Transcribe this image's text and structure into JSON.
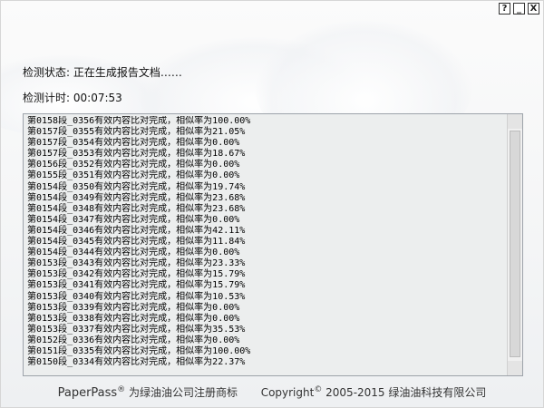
{
  "window_buttons": {
    "help": "?",
    "minimize": "_",
    "close": "X"
  },
  "status": {
    "label": "检测状态:",
    "value": "正在生成报告文档……"
  },
  "timer": {
    "label": "检测计时:",
    "value": "00:07:53"
  },
  "log_lines": [
    "第0158段_0356有效内容比对完成，相似率为100.00%",
    "第0157段_0355有效内容比对完成，相似率为21.05%",
    "第0157段_0354有效内容比对完成，相似率为0.00%",
    "第0157段_0353有效内容比对完成，相似率为18.67%",
    "第0156段_0352有效内容比对完成，相似率为0.00%",
    "第0155段_0351有效内容比对完成，相似率为0.00%",
    "第0154段_0350有效内容比对完成，相似率为19.74%",
    "第0154段_0349有效内容比对完成，相似率为23.68%",
    "第0154段_0348有效内容比对完成，相似率为23.68%",
    "第0154段_0347有效内容比对完成，相似率为0.00%",
    "第0154段_0346有效内容比对完成，相似率为42.11%",
    "第0154段_0345有效内容比对完成，相似率为11.84%",
    "第0154段_0344有效内容比对完成，相似率为0.00%",
    "第0153段_0343有效内容比对完成，相似率为23.33%",
    "第0153段_0342有效内容比对完成，相似率为15.79%",
    "第0153段_0341有效内容比对完成，相似率为15.79%",
    "第0153段_0340有效内容比对完成，相似率为10.53%",
    "第0153段_0339有效内容比对完成，相似率为0.00%",
    "第0153段_0338有效内容比对完成，相似率为0.00%",
    "第0153段_0337有效内容比对完成，相似率为35.53%",
    "第0152段_0336有效内容比对完成，相似率为0.00%",
    "第0151段_0335有效内容比对完成，相似率为100.00%",
    "第0150段_0334有效内容比对完成，相似率为22.37%"
  ],
  "footer": {
    "brand": "PaperPass",
    "registered": "®",
    "trademark_text": "为绿油油公司注册商标",
    "copyright_word": "Copyright",
    "copyright_symbol": "©",
    "copyright_text": "2005-2015 绿油油科技有限公司"
  }
}
